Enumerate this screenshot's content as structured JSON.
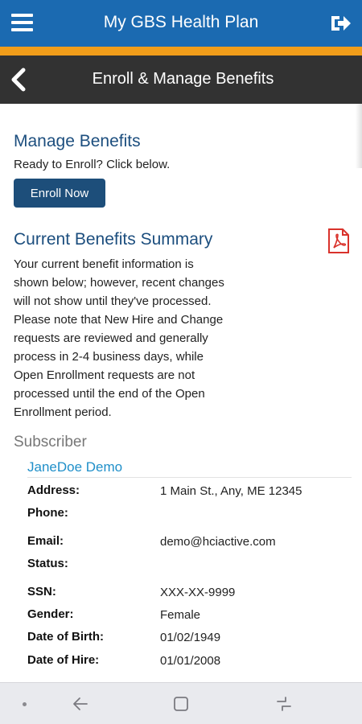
{
  "header": {
    "app_title": "My GBS Health Plan",
    "menu_icon": "hamburger-menu-icon",
    "logout_icon": "logout-icon"
  },
  "subheader": {
    "title": "Enroll & Manage Benefits",
    "back_icon": "chevron-left-icon"
  },
  "manage": {
    "title": "Manage Benefits",
    "subtitle": "Ready to Enroll? Click below.",
    "enroll_button": "Enroll Now"
  },
  "summary": {
    "title": "Current Benefits Summary",
    "pdf_icon": "pdf-icon",
    "lines": [
      "Your current benefit information is",
      "shown below; however, recent changes",
      "will not show until they've processed.",
      "Please note that New Hire and Change",
      "requests are reviewed and generally",
      "process in 2-4 business days, while",
      "Open Enrollment requests are not",
      "processed until the end of the Open",
      "Enrollment period."
    ]
  },
  "subscriber": {
    "heading": "Subscriber",
    "name": "JaneDoe Demo",
    "fields": [
      {
        "label": "Address:",
        "value": "1 Main St., Any, ME 12345"
      },
      {
        "label": "Phone:",
        "value": ""
      },
      {
        "label": "Email:",
        "value": "demo@hciactive.com"
      },
      {
        "label": "Status:",
        "value": ""
      },
      {
        "label": "SSN:",
        "value": "XXX-XX-9999"
      },
      {
        "label": "Gender:",
        "value": "Female"
      },
      {
        "label": "Date of Birth:",
        "value": "01/02/1949"
      },
      {
        "label": "Date of Hire:",
        "value": "01/01/2008"
      }
    ]
  },
  "colors": {
    "header_blue": "#1b6ab1",
    "accent_orange": "#f19d1a",
    "subheader_dark": "#323232",
    "title_navy": "#1c4e7e",
    "button_navy": "#1d4e7a",
    "name_blue": "#1f8fc9",
    "pdf_red": "#d9322b"
  }
}
